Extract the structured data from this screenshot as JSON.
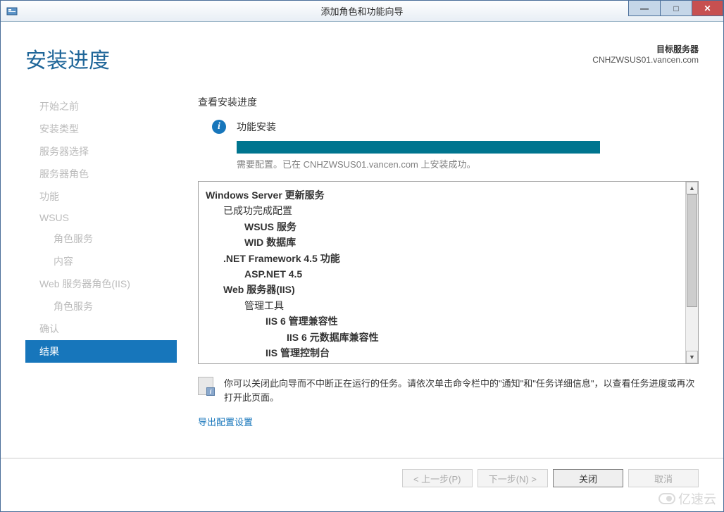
{
  "window": {
    "title": "添加角色和功能向导"
  },
  "header": {
    "page_title": "安装进度",
    "target_label": "目标服务器",
    "target_server": "CNHZWSUS01.vancen.com"
  },
  "sidebar": {
    "items": [
      {
        "label": "开始之前",
        "sub": false
      },
      {
        "label": "安装类型",
        "sub": false
      },
      {
        "label": "服务器选择",
        "sub": false
      },
      {
        "label": "服务器角色",
        "sub": false
      },
      {
        "label": "功能",
        "sub": false
      },
      {
        "label": "WSUS",
        "sub": false
      },
      {
        "label": "角色服务",
        "sub": true
      },
      {
        "label": "内容",
        "sub": true
      },
      {
        "label": "Web 服务器角色(IIS)",
        "sub": false
      },
      {
        "label": "角色服务",
        "sub": true
      },
      {
        "label": "确认",
        "sub": false
      },
      {
        "label": "结果",
        "sub": false,
        "active": true
      }
    ]
  },
  "main": {
    "section_label": "查看安装进度",
    "status_title": "功能安装",
    "status_message": "需要配置。已在 CNHZWSUS01.vancen.com 上安装成功。",
    "results": [
      {
        "cls": "l0",
        "text": "Windows Server 更新服务"
      },
      {
        "cls": "l1",
        "text": "已成功完成配置"
      },
      {
        "cls": "l2",
        "text": "WSUS 服务"
      },
      {
        "cls": "l2",
        "text": "WID 数据库"
      },
      {
        "cls": "l1b",
        "text": ".NET Framework 4.5 功能"
      },
      {
        "cls": "l2",
        "text": "ASP.NET 4.5"
      },
      {
        "cls": "l1b",
        "text": "Web 服务器(IIS)"
      },
      {
        "cls": "l2n",
        "text": "管理工具"
      },
      {
        "cls": "l3",
        "text": "IIS 6 管理兼容性"
      },
      {
        "cls": "l4",
        "text": "IIS 6 元数据库兼容性"
      },
      {
        "cls": "l3",
        "text": "IIS 管理控制台"
      }
    ],
    "hint_text": "你可以关闭此向导而不中断正在运行的任务。请依次单击命令栏中的\"通知\"和\"任务详细信息\"，以查看任务进度或再次打开此页面。",
    "export_link": "导出配置设置"
  },
  "buttons": {
    "prev": "< 上一步(P)",
    "next": "下一步(N) >",
    "close": "关闭",
    "cancel": "取消"
  },
  "watermark": "亿速云"
}
